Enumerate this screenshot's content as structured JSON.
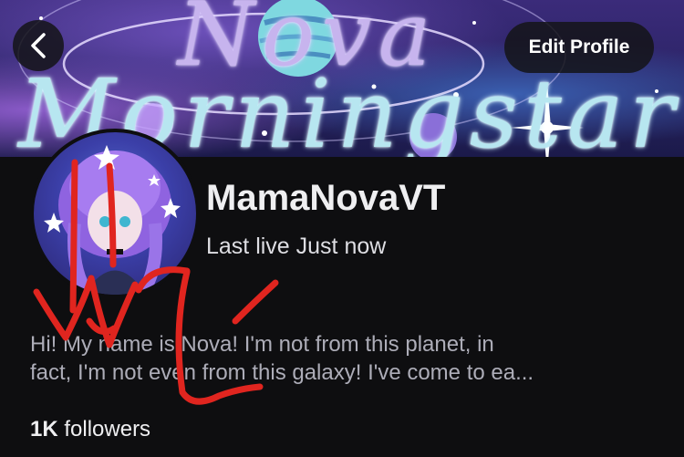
{
  "banner": {
    "title_line1": "Nova",
    "title_line2": "Morningstar",
    "icons": [
      "planet-icon",
      "star-icon",
      "orbit-ring"
    ]
  },
  "header": {
    "back_icon": "chevron-left-icon",
    "edit_label": "Edit Profile"
  },
  "profile": {
    "username": "MamaNovaVT",
    "last_live": "Last live Just now",
    "bio_line1": "Hi! My name is Nova! I'm not from this planet, in",
    "bio_line2": "fact, I'm not even from this galaxy! I've come to ea...",
    "followers_count": "1K",
    "followers_label": "followers"
  },
  "colors": {
    "background": "#0e0e10",
    "scribble": "#e0251f",
    "bio_text": "#adadb8"
  }
}
